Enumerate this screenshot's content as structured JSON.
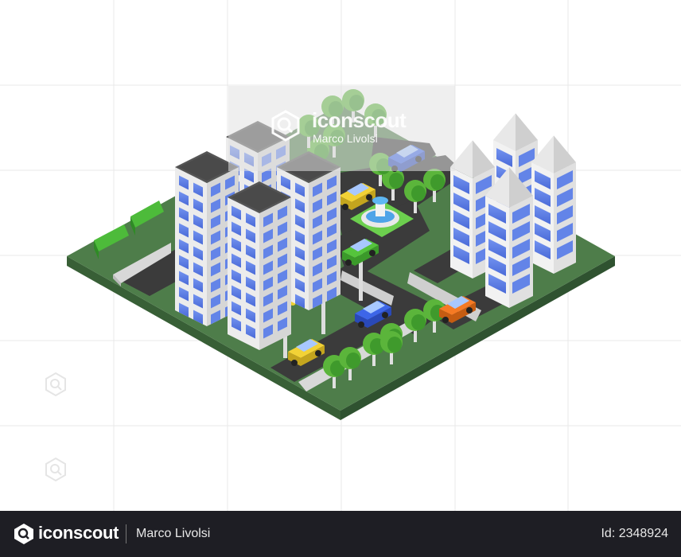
{
  "watermark": {
    "brand": "iconscout",
    "author": "Marco Livolsi"
  },
  "footer": {
    "brand": "iconscout",
    "author": "Marco Livolsi",
    "asset_id": "Id: 2348924"
  },
  "colors": {
    "ground_top": "#4e7d4a",
    "ground_side": "#385f36",
    "road": "#3b3b3b",
    "building_window": "#5b7ee6",
    "building_white": "#f0f0f0",
    "roof": "#555555",
    "tree": "#5bb53b",
    "footer_bg": "#1e1e24"
  },
  "icons": [
    "iconscout-logo-icon",
    "watermark-search-icon"
  ]
}
